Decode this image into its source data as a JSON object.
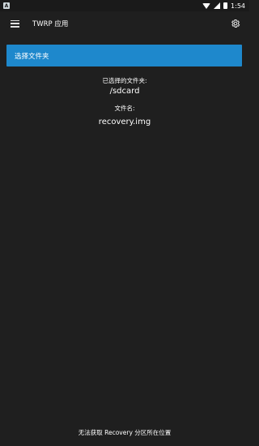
{
  "status_bar": {
    "time": "1:54",
    "app_icon": "a-icon",
    "icons": [
      "wifi-icon",
      "signal-icon",
      "battery-icon"
    ]
  },
  "app_bar": {
    "title": "TWRP 应用",
    "menu_icon": "menu-icon",
    "settings_icon": "gear-icon"
  },
  "main": {
    "select_folder_button": "选择文件夹",
    "selected_folder_label": "已选择的文件夹:",
    "selected_folder_value": "/sdcard",
    "filename_label": "文件名:",
    "filename_value": "recovery.img"
  },
  "footer": {
    "status_text": "无法获取 Recovery 分区所在位置"
  },
  "colors": {
    "background": "#1f1f1f",
    "accent": "#1e88cc",
    "text": "#ffffff"
  }
}
